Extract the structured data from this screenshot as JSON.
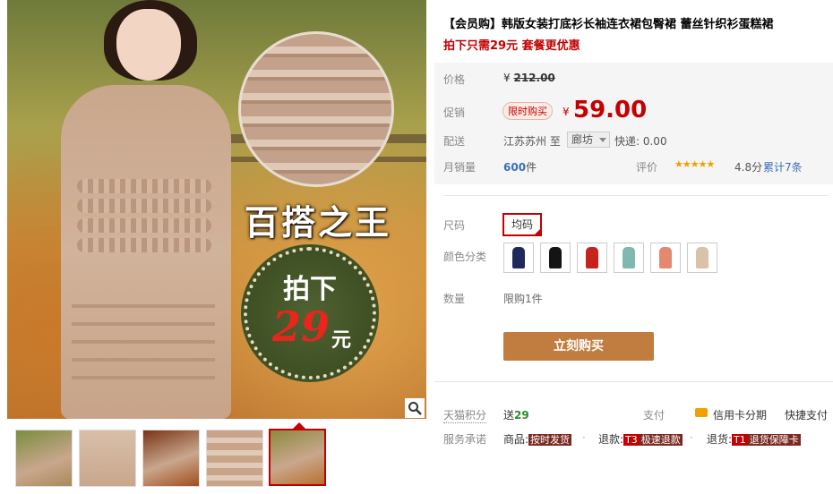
{
  "product": {
    "title": "【会员购】韩版女装打底衫长袖连衣裙包臀裙 蕾丝针织衫蛋糕裙",
    "subtitle": "拍下只需29元 套餐更优惠"
  },
  "image": {
    "slogan": "百搭之王",
    "badge_top": "拍下",
    "badge_price": "29",
    "badge_unit": "元"
  },
  "thumbnails": [
    "thumb-1",
    "thumb-2",
    "thumb-3",
    "thumb-4",
    "thumb-5"
  ],
  "price": {
    "label": "价格",
    "currency": "¥",
    "original": "212.00",
    "promo_label": "促销",
    "promo_tag": "限时购买",
    "sale": "59.00"
  },
  "shipping": {
    "label": "配送",
    "from": "江苏苏州",
    "to_word": "至",
    "to_city": "廊坊",
    "express": "快递: 0.00"
  },
  "sales": {
    "label": "月销量",
    "count": "600",
    "unit": "件",
    "rating_label": "评价",
    "stars": "★★★★★",
    "score": "4.8分",
    "reviews": "累计7条"
  },
  "options": {
    "size_label": "尺码",
    "size_value": "均码",
    "color_label": "颜色分类",
    "colors": [
      "#1f2a5c",
      "#141414",
      "#c8221d",
      "#7fb8b0",
      "#e58870",
      "#d9c2a8"
    ],
    "qty_label": "数量",
    "qty_limit": "限购1件"
  },
  "buy_button": "立刻购买",
  "footer": {
    "points_label": "天猫积分",
    "points_prefix": "送",
    "points_value": "29",
    "pay_label": "支付",
    "installment": "信用卡分期",
    "quickpay": "快捷支付",
    "promise_label": "服务承诺",
    "p1_prefix": "商品:",
    "p1_tag": "按时发货",
    "p2_prefix": "退款:",
    "p2_code": "T3",
    "p2_tag": "极速退款",
    "p3_prefix": "退货:",
    "p3_code": "T1",
    "p3_tag": "退货保障卡"
  }
}
